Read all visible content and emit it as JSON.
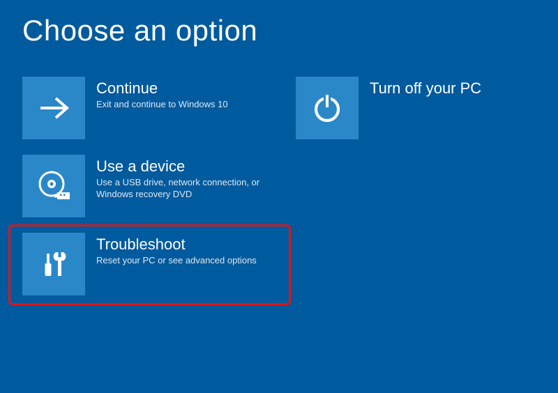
{
  "title": "Choose an option",
  "tiles": {
    "continue": {
      "title": "Continue",
      "desc": "Exit and continue to Windows 10"
    },
    "turnoff": {
      "title": "Turn off your PC",
      "desc": ""
    },
    "device": {
      "title": "Use a device",
      "desc": "Use a USB drive, network connection, or Windows recovery DVD"
    },
    "troubleshoot": {
      "title": "Troubleshoot",
      "desc": "Reset your PC or see advanced options"
    }
  }
}
